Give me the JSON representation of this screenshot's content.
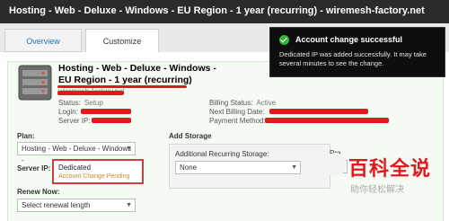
{
  "window": {
    "title": "Hosting - Web - Deluxe - Windows - EU Region - 1 year (recurring) - wiremesh-factory.net"
  },
  "tabs": [
    {
      "label": "Overview"
    },
    {
      "label": "Customize"
    }
  ],
  "product": {
    "title_line1": "Hosting - Web - Deluxe - Windows -",
    "title_line2": "EU Region - 1 year (recurring)",
    "domain": "wiremesh-factory.net",
    "status_label": "Status:",
    "status_value": "Setup",
    "login_label": "Login:",
    "serverip_label": "Server IP:",
    "billing_status_label": "Billing Status:",
    "billing_status_value": "Active",
    "next_billing_label": "Next Billing Date:",
    "payment_method_label": "Payment Method:"
  },
  "plan": {
    "label": "Plan:",
    "selected": "Hosting - Web - Deluxe - Windows -"
  },
  "serverip_option": {
    "label": "Server IP:",
    "value": "Dedicated",
    "status": "Account Change Pending"
  },
  "renew": {
    "label": "Renew Now:",
    "selected": "Select renewal length"
  },
  "storage": {
    "title": "Add Storage",
    "additional_label": "Additional Recurring Storage:",
    "selected": "None",
    "pre_label": "Pre",
    "pre_selected": "-S"
  },
  "notification": {
    "title": "Account change successful",
    "message": "Dedicated IP was added successfully. It may take several minutes to see the change."
  },
  "watermark": {
    "big": "百科全说",
    "small": "助你轻松解决"
  },
  "colors": {
    "redaction": "#e1191e",
    "success": "#3bb33b",
    "pending": "#d08b27"
  },
  "icons": {
    "server": "server-icon",
    "success": "check-circle-icon"
  }
}
